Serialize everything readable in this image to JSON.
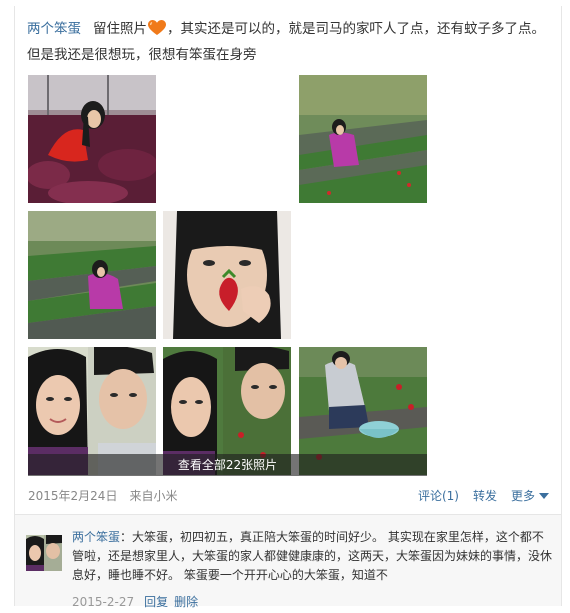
{
  "post": {
    "author": "两个笨蛋",
    "text_before_heart": "留住照片",
    "text_after_heart": "，其实还是可以的，就是司马的家吓人了点，还有蚊子多了点。但是我还是很想玩，很想有笨蛋在身旁",
    "view_all_label": "查看全部22张照片",
    "date": "2015年2月24日",
    "source": "来自小米",
    "comment_label": "评论(1)",
    "forward_label": "转发",
    "more_label": "更多"
  },
  "photos": [
    {
      "icon": "photo-girl-red-jacket-strawberry-field"
    },
    {
      "icon": "photo-girl-purple-kneeling-field"
    },
    {
      "icon": "photo-girl-purple-crouching-field"
    },
    {
      "icon": "photo-girl-kissing-strawberry"
    },
    {
      "icon": "photo-couple-selfie-1"
    },
    {
      "icon": "photo-couple-selfie-2"
    },
    {
      "icon": "photo-boy-picking-strawberries"
    }
  ],
  "comment": {
    "author": "两个笨蛋",
    "text": "：大笨蛋，初四初五，真正陪大笨蛋的时间好少。 其实现在家里怎样，这个都不管啦，还是想家里人，大笨蛋的家人都健健康康的，这两天，大笨蛋因为妹妹的事情，没休息好，睡也睡不好。 笨蛋要一个开开心心的大笨蛋，知道不",
    "date": "2015-2-27",
    "reply_label": "回复",
    "delete_label": "删除"
  },
  "colors": {
    "link": "#3b6f9e",
    "meta_gray": "#888888",
    "comment_bg": "#f7f7f7"
  }
}
